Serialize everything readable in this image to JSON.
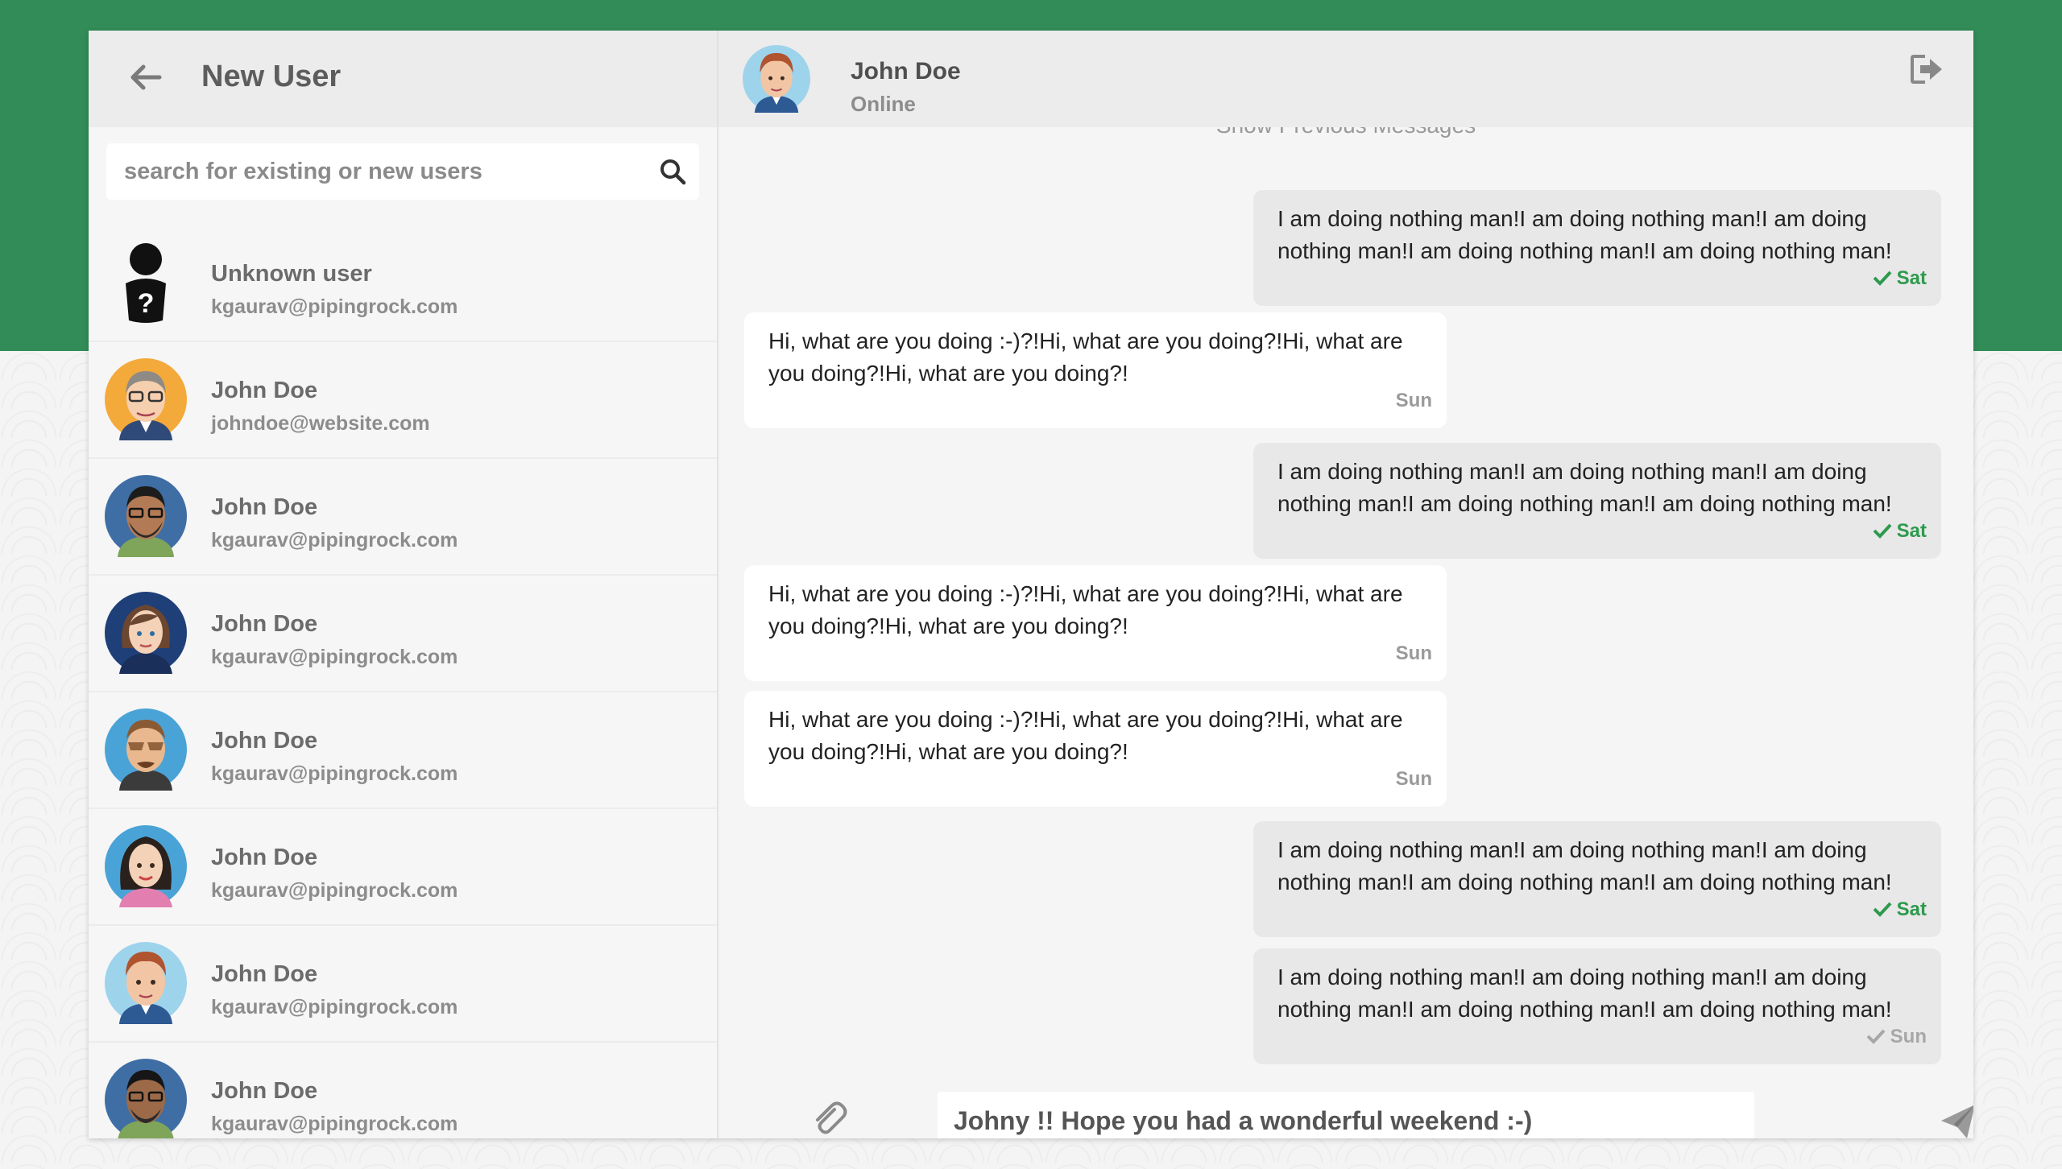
{
  "sidebar": {
    "title": "New User",
    "search": {
      "placeholder": "search for existing or new users",
      "value": ""
    },
    "users": [
      {
        "name": "Unknown user",
        "email": "kgaurav@pipingrock.com",
        "avatar": "unknown-user-icon"
      },
      {
        "name": "John Doe",
        "email": "johndoe@website.com",
        "avatar": "avatar-orange-glasses"
      },
      {
        "name": "John Doe",
        "email": "kgaurav@pipingrock.com",
        "avatar": "avatar-blue-beard-glasses"
      },
      {
        "name": "John Doe",
        "email": "kgaurav@pipingrock.com",
        "avatar": "avatar-navy-woman"
      },
      {
        "name": "John Doe",
        "email": "kgaurav@pipingrock.com",
        "avatar": "avatar-blue-sunglasses"
      },
      {
        "name": "John Doe",
        "email": "kgaurav@pipingrock.com",
        "avatar": "avatar-blue-woman"
      },
      {
        "name": "John Doe",
        "email": "kgaurav@pipingrock.com",
        "avatar": "avatar-lightblue-man"
      },
      {
        "name": "John Doe",
        "email": "kgaurav@pipingrock.com",
        "avatar": "avatar-blue-glasses"
      }
    ]
  },
  "chat": {
    "contact_name": "John Doe",
    "contact_status": "Online",
    "show_previous_label": "Show Previous Messages",
    "messages": [
      {
        "direction": "out",
        "text": "I am doing nothing man!I am doing nothing man!I am doing nothing man!I am doing nothing man!I am doing nothing man!",
        "time": "Sat",
        "read": true
      },
      {
        "direction": "in",
        "text": "Hi, what are you doing :-)?!Hi, what are you doing?!Hi, what are you doing?!Hi, what are you doing?!",
        "time": "Sun"
      },
      {
        "direction": "out",
        "text": "I am doing nothing man!I am doing nothing man!I am doing nothing man!I am doing nothing man!I am doing nothing man!",
        "time": "Sat",
        "read": true
      },
      {
        "direction": "in",
        "text": "Hi, what are you doing :-)?!Hi, what are you doing?!Hi, what are you doing?!Hi, what are you doing?!",
        "time": "Sun"
      },
      {
        "direction": "in",
        "text": "Hi, what are you doing :-)?!Hi, what are you doing?!Hi, what are you doing?!Hi, what are you doing?!",
        "time": "Sun"
      },
      {
        "direction": "out",
        "text": "I am doing nothing man!I am doing nothing man!I am doing nothing man!I am doing nothing man!I am doing nothing man!",
        "time": "Sat",
        "read": true
      },
      {
        "direction": "out",
        "text": "I am doing nothing man!I am doing nothing man!I am doing nothing man!I am doing nothing man!I am doing nothing man!",
        "time": "Sun",
        "read": false
      }
    ],
    "composer": {
      "value": "Johny !! Hope you had a wonderful weekend :-)"
    }
  },
  "colors": {
    "brand_green": "#318c57",
    "read_tick": "#2d9a4e",
    "unread_tick": "#a7a7a7"
  }
}
